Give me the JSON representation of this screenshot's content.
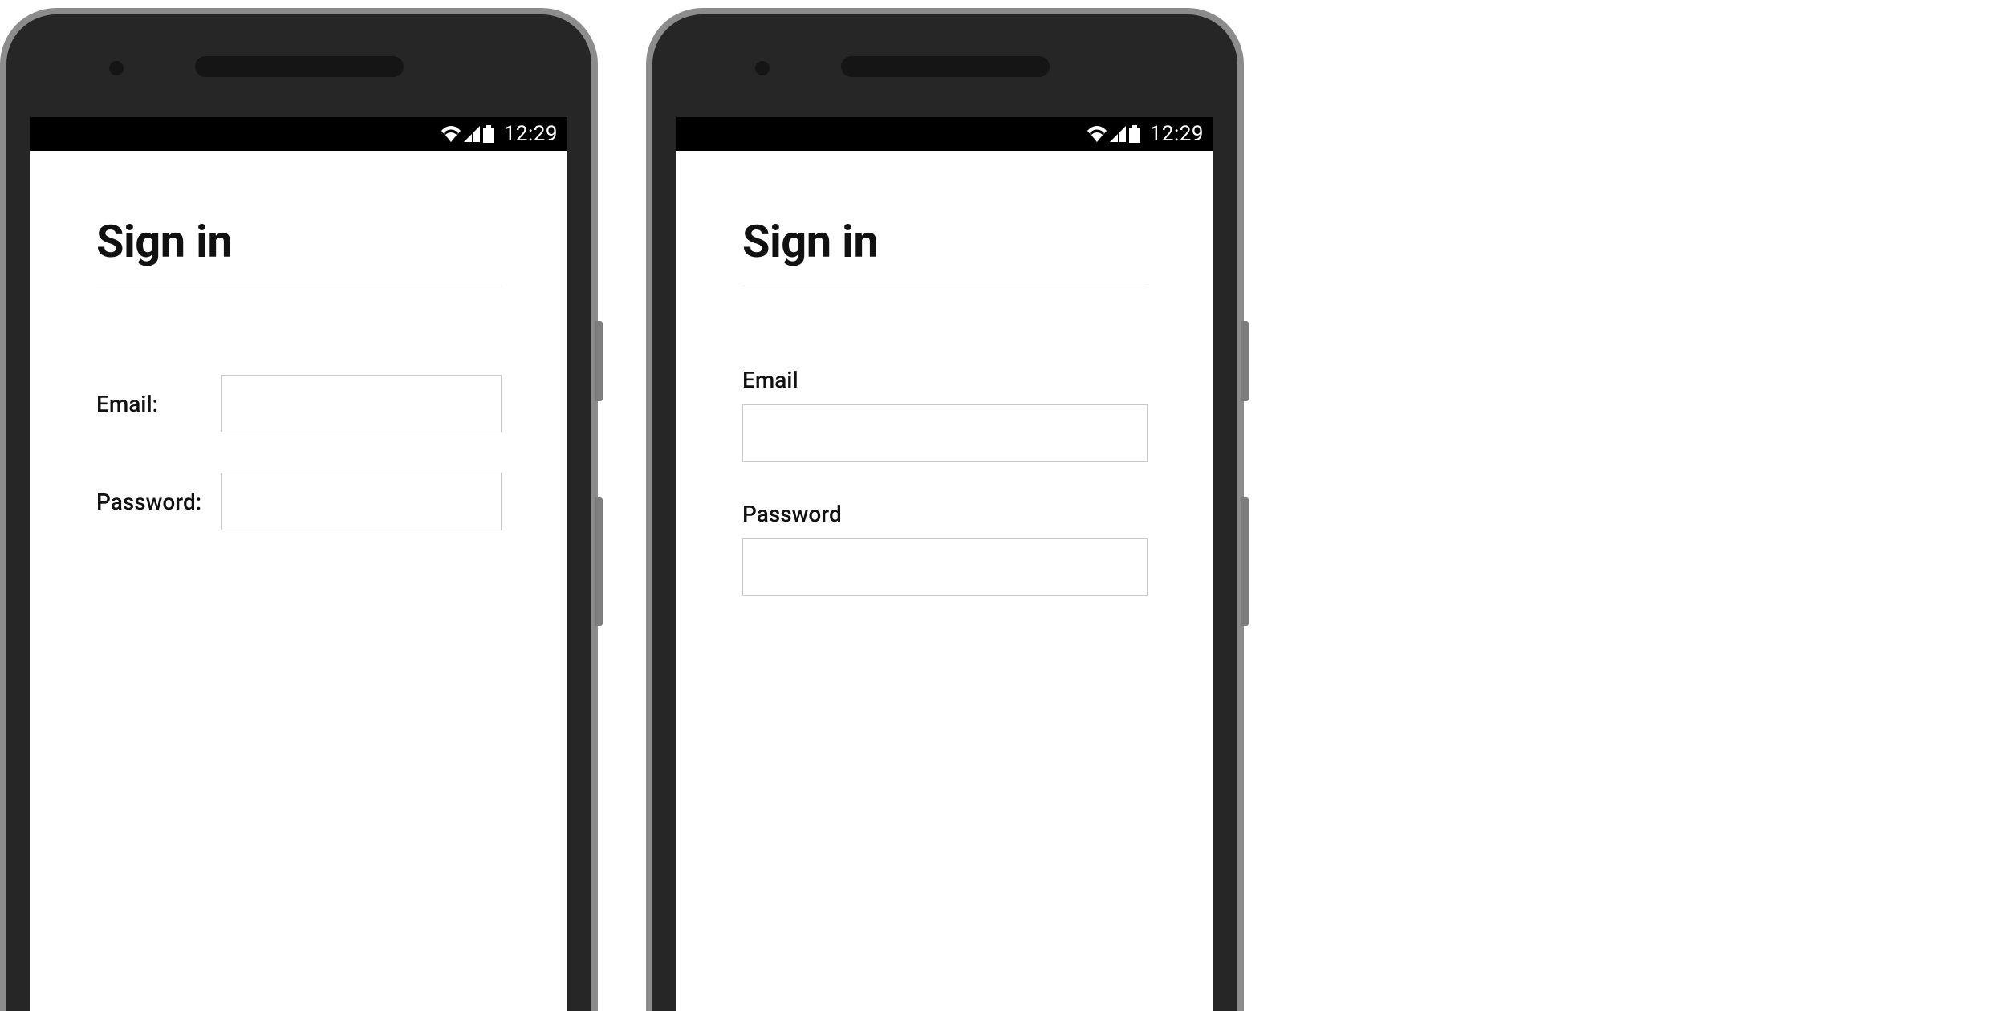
{
  "status": {
    "time": "12:29"
  },
  "phoneA": {
    "title": "Sign in",
    "email_label": "Email:",
    "password_label": "Password:",
    "email_value": "",
    "password_value": ""
  },
  "phoneB": {
    "title": "Sign in",
    "email_label": "Email",
    "password_label": "Password",
    "email_value": "",
    "password_value": ""
  }
}
